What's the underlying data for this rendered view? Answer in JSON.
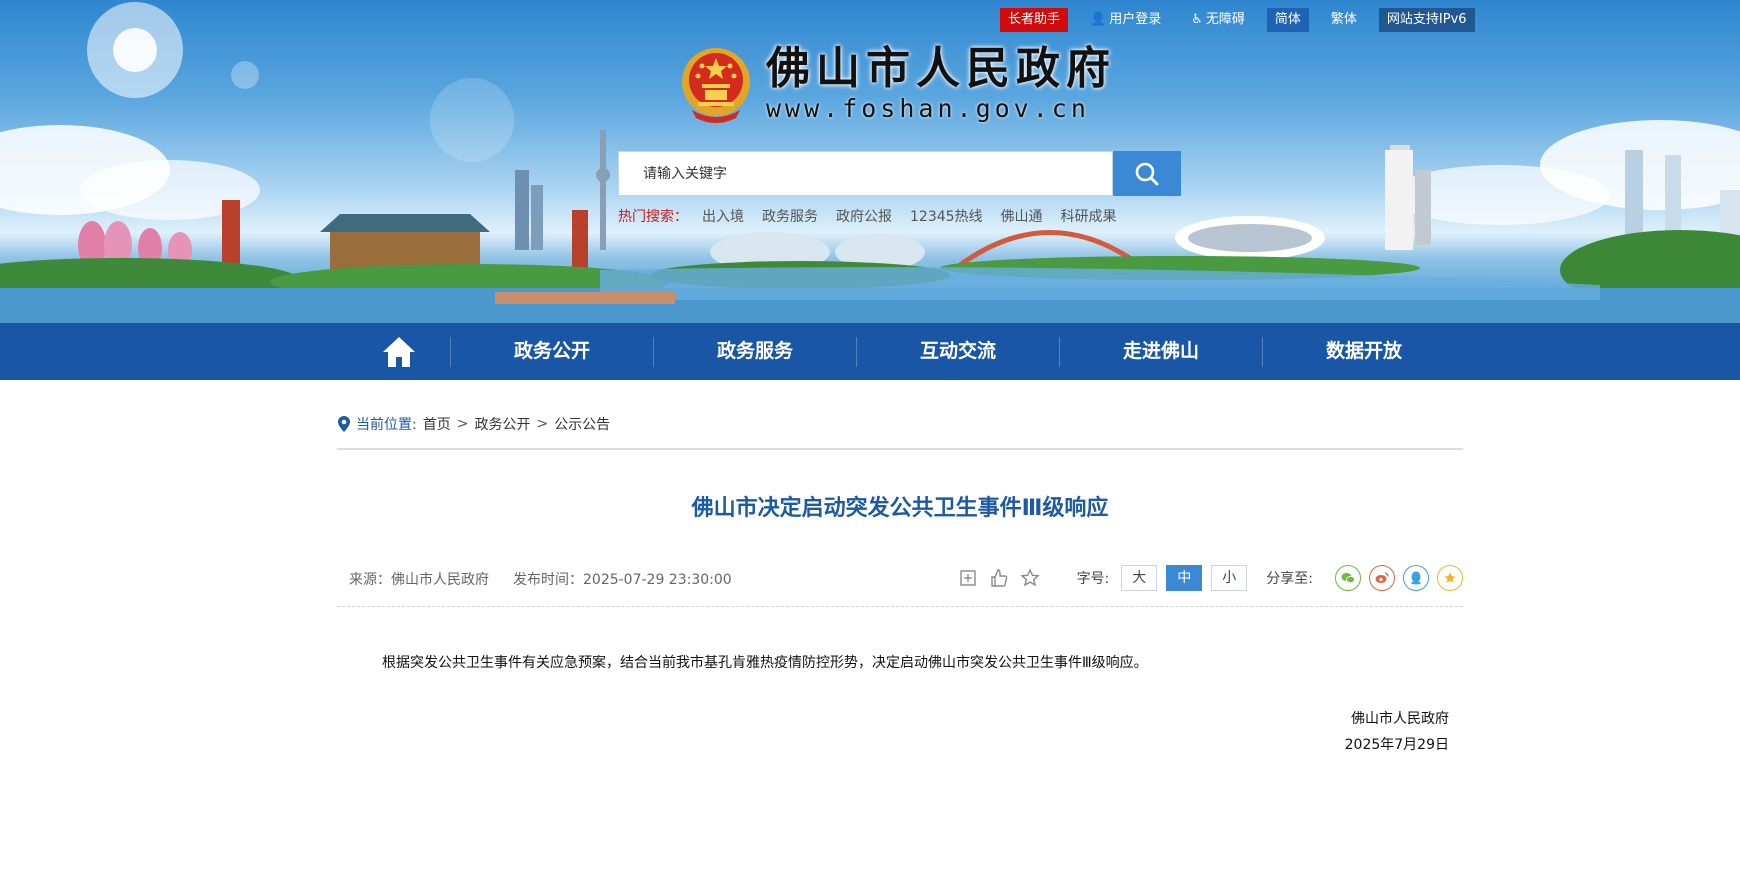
{
  "topbar": {
    "elder_assistant": "长者助手",
    "login": "用户登录",
    "accessibility": "无障碍",
    "simplified": "简体",
    "traditional": "繁体",
    "ipv6": "网站支持IPv6"
  },
  "header": {
    "site_name": "佛山市人民政府",
    "site_url": "www.foshan.gov.cn"
  },
  "search": {
    "placeholder": "请输入关键字",
    "button_icon": "search-icon",
    "hot_label": "热门搜索：",
    "hot_terms": [
      "出入境",
      "政务服务",
      "政府公报",
      "12345热线",
      "佛山通",
      "科研成果"
    ]
  },
  "nav": {
    "home_icon": "home-icon",
    "items": [
      "政务公开",
      "政务服务",
      "互动交流",
      "走进佛山",
      "数据开放"
    ]
  },
  "breadcrumb": {
    "label": "当前位置:",
    "items": [
      "首页",
      "政务公开",
      "公示公告"
    ],
    "separator": ">"
  },
  "article": {
    "title": "佛山市决定启动突发公共卫生事件Ⅲ级响应",
    "source": "来源：佛山市人民政府",
    "published": "发布时间：2025-07-29 23:30:00",
    "font_size_label": "字号:",
    "font_sizes": [
      "大",
      "中",
      "小"
    ],
    "font_size_selected": "中",
    "share_label": "分享至:",
    "body": "根据突发公共卫生事件有关应急预案，结合当前我市基孔肯雅热疫情防控形势，决定启动佛山市突发公共卫生事件Ⅲ级响应。",
    "signature_org": "佛山市人民政府",
    "signature_date": "2025年7月29日"
  },
  "colors": {
    "nav_bg": "#1a56a6",
    "title": "#1c5aa6",
    "accent": "#3b88d4",
    "elder_red": "#d20a0a"
  }
}
